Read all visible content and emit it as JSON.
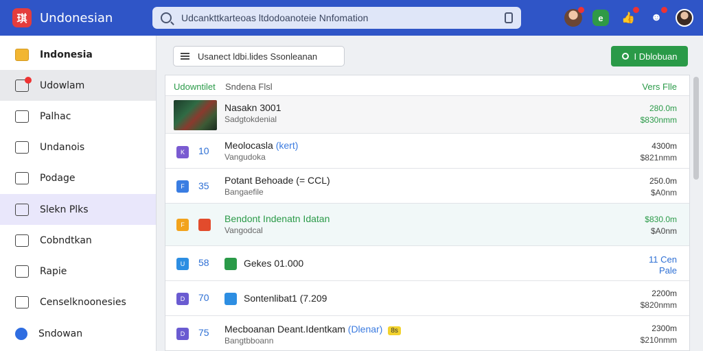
{
  "app": {
    "name": "Undonesian",
    "logo_text": "琪"
  },
  "search": {
    "text": "Udcankttkarteoas ltdodoanoteie Nnfomation"
  },
  "top_icons": [
    "avatar-user",
    "green-app-icon",
    "thumbs-up-icon",
    "notification-icon",
    "avatar-profile"
  ],
  "green_icon_text": "e",
  "sidebar": {
    "items": [
      {
        "label": "Indonesia",
        "icon": "folder-icon"
      },
      {
        "label": "Udowlam",
        "icon": "bell-icon"
      },
      {
        "label": "Palhac",
        "icon": "clock-icon"
      },
      {
        "label": "Undanois",
        "icon": "document-icon"
      },
      {
        "label": "Podage",
        "icon": "home-icon"
      },
      {
        "label": "Slekn Plks",
        "icon": "square-icon"
      },
      {
        "label": "Cobndtkan",
        "icon": "edit-icon"
      },
      {
        "label": "Rapie",
        "icon": "box-icon"
      },
      {
        "label": "Censelknoonesies",
        "icon": "calendar-icon"
      },
      {
        "label": "Sndowan",
        "icon": "circle-icon"
      }
    ]
  },
  "toolbar": {
    "filter_text": "Usanect ldbi.lides Ssonleanan",
    "upload_label": "I Dblobuan"
  },
  "table": {
    "headers": {
      "col1": "Udowntilet",
      "col2": "Sndena Flsl",
      "col3": "Vers Flle"
    },
    "rows": [
      {
        "badge": "",
        "num": "",
        "title": "Nasakn 3001",
        "tag": "",
        "ytag": "",
        "sub": "Sadgtokdenial",
        "v1": "280.0m",
        "v2": "$830nmm",
        "color": "#2a9a48"
      },
      {
        "badge": "K",
        "num": "10",
        "title": "Meolocasla",
        "tag": "(kert)",
        "ytag": "",
        "sub": "Vangudoka",
        "v1": "4300m",
        "v2": "$821nmm",
        "color": "#333"
      },
      {
        "badge": "F",
        "num": "35",
        "title": "Potant Behoade (= CCL)",
        "tag": "",
        "ytag": "",
        "sub": "Bangaefile",
        "v1": "250.0m",
        "v2": "$A0nm",
        "color": "#333"
      },
      {
        "badge": "F",
        "num": "",
        "title": "Bendont Indenatn Idatan",
        "tag": "",
        "ytag": "",
        "sub": "Vangodcal",
        "v1": "$830.0m",
        "v2": "$A0nm",
        "color": "#2a9a48"
      },
      {
        "badge": "U",
        "num": "58",
        "title": "Gekes 01.000",
        "tag": "",
        "ytag": "",
        "sub": "",
        "v1": "11 Cen",
        "v2": "Pale",
        "color": "#2d6fd4"
      },
      {
        "badge": "D",
        "num": "70",
        "title": "Sontenlibat1 (7.209",
        "tag": "",
        "ytag": "",
        "sub": "",
        "v1": "2200m",
        "v2": "$820nmm",
        "color": "#333"
      },
      {
        "badge": "D",
        "num": "75",
        "title": "Mecboanan Deant.Identkam",
        "tag": "(Dlenar)",
        "ytag": "8s",
        "sub": "Bangtbboann",
        "v1": "2300m",
        "v2": "$210nmm",
        "color": "#333"
      }
    ]
  },
  "colors": {
    "topbar": "#2f55c7",
    "accent_green": "#2a9a48",
    "link_blue": "#2d6fd4"
  }
}
